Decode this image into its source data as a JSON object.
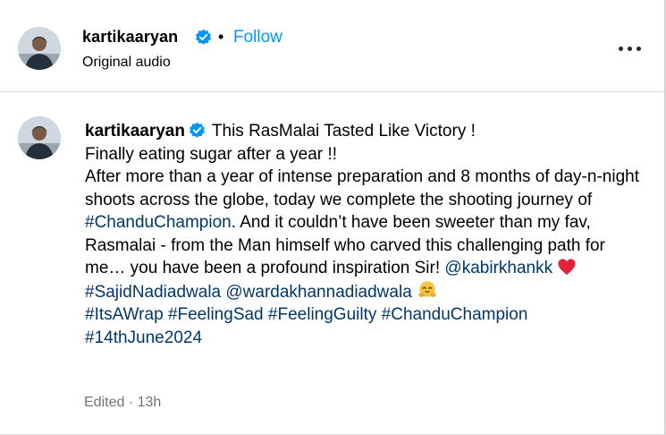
{
  "header": {
    "username": "kartikaaryan",
    "separator": "•",
    "follow_label": "Follow",
    "audio_label": "Original audio",
    "verified_icon": "verified-badge-icon",
    "more_icon": "more-options-icon"
  },
  "caption": {
    "username": "kartikaaryan",
    "title": "This RasMalai Tasted Like Victory !",
    "line2": "Finally eating sugar after a year !!",
    "body_before_tag": "After more than a year of intense preparation and 8 months of day-n-night shoots across the globe, today we complete the shooting journey of",
    "tag_chandu": "#ChanduChampion",
    "body_after_tag": ". And it couldn’t have been sweeter than my fav, Rasmalai - from the Man himself who carved this challenging path for me… you have been a profound inspiration Sir!",
    "mention_kabir": "@kabirkhankk",
    "heart_icon": "red-heart-icon",
    "tag_sajid": "#SajidNadiadwala",
    "mention_warda": "@wardakhannadiadwala",
    "hug_icon": "hugging-face-icon",
    "tags_line": [
      "#ItsAWrap",
      "#FeelingSad",
      "#FeelingGuilty",
      "#ChanduChampion"
    ],
    "tag_date": "#14thJune2024"
  },
  "meta": {
    "text": "Edited · 13h"
  },
  "colors": {
    "link": "#0095f6",
    "hashtag": "#00376b",
    "verified": "#0095f6",
    "muted": "#737373"
  }
}
